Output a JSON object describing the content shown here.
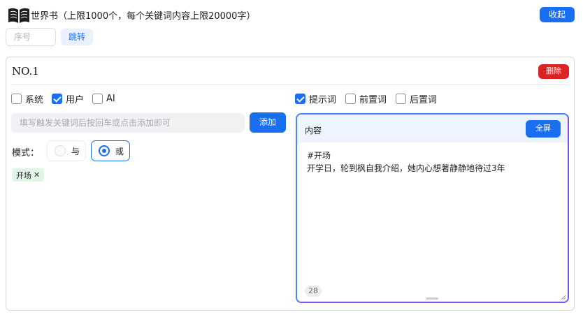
{
  "header": {
    "title": "世界书（上限1000个，每个关键词内容上限20000字）",
    "collapse_label": "收起"
  },
  "jump": {
    "placeholder": "序号",
    "button_label": "跳转"
  },
  "entry": {
    "title": "NO.1",
    "delete_label": "删除",
    "roles": [
      {
        "label": "系统",
        "checked": false
      },
      {
        "label": "用户",
        "checked": true
      },
      {
        "label": "AI",
        "checked": false
      }
    ],
    "word_types": [
      {
        "label": "提示词",
        "checked": true
      },
      {
        "label": "前置词",
        "checked": false
      },
      {
        "label": "后置词",
        "checked": false
      }
    ],
    "keyword_placeholder": "填写触发关键词后按回车或点击添加即可",
    "add_label": "添加",
    "mode_label": "模式：",
    "modes": [
      {
        "label": "与",
        "selected": false
      },
      {
        "label": "或",
        "selected": true
      }
    ],
    "tags": [
      {
        "label": "开场",
        "close": "✕"
      }
    ],
    "content": {
      "title": "内容",
      "fullscreen_label": "全屏",
      "lines": [
        "#开场",
        "开学日，轮到枫自我介绍，她内心想著静静地待过3年"
      ],
      "char_count": "28"
    }
  },
  "colors": {
    "primary": "#1a6ef0",
    "danger": "#d92424",
    "tag_bg": "#dff5e6",
    "editor_header_bg": "#eef4fe"
  }
}
